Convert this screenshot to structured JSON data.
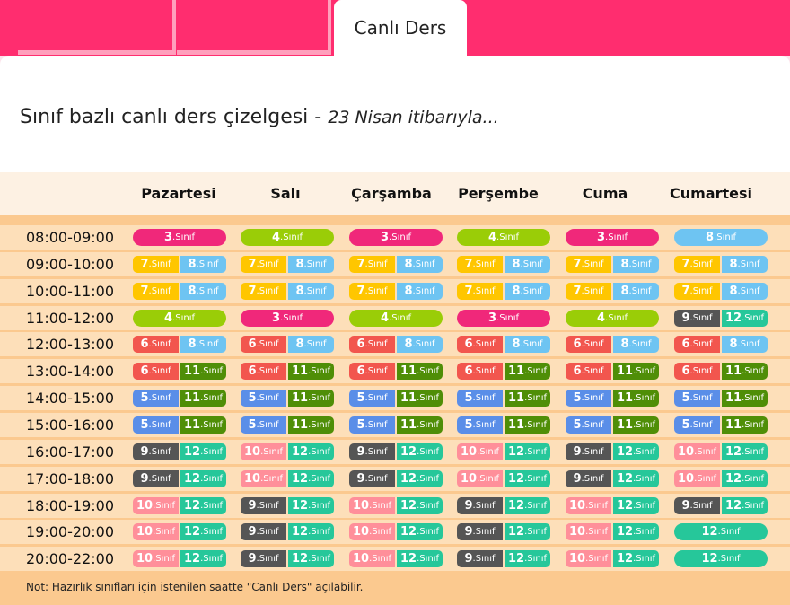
{
  "tabs": {
    "active_label": "Canlı Ders"
  },
  "heading": {
    "main": "Sınıf bazlı canlı ders çizelgesi - ",
    "sub": "23 Nisan itibarıyla..."
  },
  "days": [
    "Pazartesi",
    "Salı",
    "Çarşamba",
    "Perşembe",
    "Cuma",
    "Cumartesi"
  ],
  "suffix": ".Sınıf",
  "colors": {
    "3": "#f0287a",
    "4": "#9acd07",
    "5": "#5a8ee8",
    "6": "#f2564e",
    "7": "#ffc600",
    "8": "#6ec4f2",
    "9": "#555555",
    "10": "#ff8f9a",
    "11": "#4f8e07",
    "12": "#26c79a"
  },
  "schedule": [
    {
      "time": "08:00-09:00",
      "cells": [
        [
          "3"
        ],
        [
          "4"
        ],
        [
          "3"
        ],
        [
          "4"
        ],
        [
          "3"
        ],
        [
          "8"
        ]
      ]
    },
    {
      "time": "09:00-10:00",
      "cells": [
        [
          "7",
          "8"
        ],
        [
          "7",
          "8"
        ],
        [
          "7",
          "8"
        ],
        [
          "7",
          "8"
        ],
        [
          "7",
          "8"
        ],
        [
          "7",
          "8"
        ]
      ]
    },
    {
      "time": "10:00-11:00",
      "cells": [
        [
          "7",
          "8"
        ],
        [
          "7",
          "8"
        ],
        [
          "7",
          "8"
        ],
        [
          "7",
          "8"
        ],
        [
          "7",
          "8"
        ],
        [
          "7",
          "8"
        ]
      ]
    },
    {
      "time": "11:00-12:00",
      "cells": [
        [
          "4"
        ],
        [
          "3"
        ],
        [
          "4"
        ],
        [
          "3"
        ],
        [
          "4"
        ],
        [
          "9",
          "12"
        ]
      ]
    },
    {
      "time": "12:00-13:00",
      "cells": [
        [
          "6",
          "8"
        ],
        [
          "6",
          "8"
        ],
        [
          "6",
          "8"
        ],
        [
          "6",
          "8"
        ],
        [
          "6",
          "8"
        ],
        [
          "6",
          "8"
        ]
      ]
    },
    {
      "time": "13:00-14:00",
      "cells": [
        [
          "6",
          "11"
        ],
        [
          "6",
          "11"
        ],
        [
          "6",
          "11"
        ],
        [
          "6",
          "11"
        ],
        [
          "6",
          "11"
        ],
        [
          "6",
          "11"
        ]
      ]
    },
    {
      "time": "14:00-15:00",
      "cells": [
        [
          "5",
          "11"
        ],
        [
          "5",
          "11"
        ],
        [
          "5",
          "11"
        ],
        [
          "5",
          "11"
        ],
        [
          "5",
          "11"
        ],
        [
          "5",
          "11"
        ]
      ]
    },
    {
      "time": "15:00-16:00",
      "cells": [
        [
          "5",
          "11"
        ],
        [
          "5",
          "11"
        ],
        [
          "5",
          "11"
        ],
        [
          "5",
          "11"
        ],
        [
          "5",
          "11"
        ],
        [
          "5",
          "11"
        ]
      ]
    },
    {
      "time": "16:00-17:00",
      "cells": [
        [
          "9",
          "12"
        ],
        [
          "10",
          "12"
        ],
        [
          "9",
          "12"
        ],
        [
          "10",
          "12"
        ],
        [
          "9",
          "12"
        ],
        [
          "10",
          "12"
        ]
      ]
    },
    {
      "time": "17:00-18:00",
      "cells": [
        [
          "9",
          "12"
        ],
        [
          "10",
          "12"
        ],
        [
          "9",
          "12"
        ],
        [
          "10",
          "12"
        ],
        [
          "9",
          "12"
        ],
        [
          "10",
          "12"
        ]
      ]
    },
    {
      "time": "18:00-19:00",
      "cells": [
        [
          "10",
          "12"
        ],
        [
          "9",
          "12"
        ],
        [
          "10",
          "12"
        ],
        [
          "9",
          "12"
        ],
        [
          "10",
          "12"
        ],
        [
          "9",
          "12"
        ]
      ]
    },
    {
      "time": "19:00-20:00",
      "cells": [
        [
          "10",
          "12"
        ],
        [
          "9",
          "12"
        ],
        [
          "10",
          "12"
        ],
        [
          "9",
          "12"
        ],
        [
          "10",
          "12"
        ],
        [
          "12"
        ]
      ]
    },
    {
      "time": "20:00-22:00",
      "cells": [
        [
          "10",
          "12"
        ],
        [
          "9",
          "12"
        ],
        [
          "10",
          "12"
        ],
        [
          "9",
          "12"
        ],
        [
          "10",
          "12"
        ],
        [
          "12"
        ]
      ]
    }
  ],
  "note": "Not: Hazırlık sınıfları için istenilen saatte \"Canlı Ders\" açılabilir."
}
